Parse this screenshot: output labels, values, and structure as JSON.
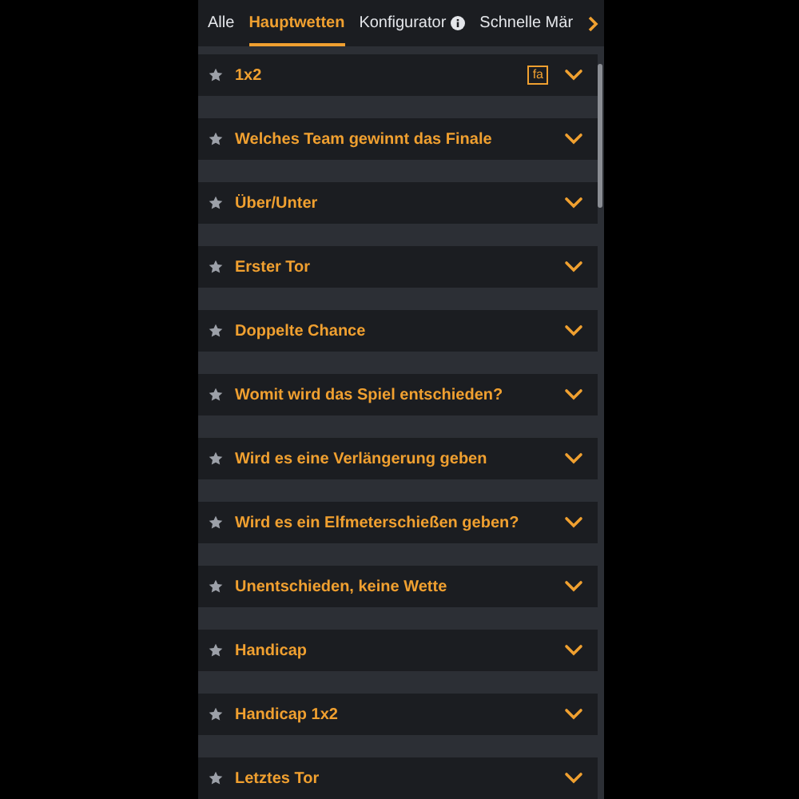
{
  "tabs": [
    {
      "label": "Alle",
      "selected": false
    },
    {
      "label": "Hauptwetten",
      "selected": true
    },
    {
      "label": "Konfigurator",
      "selected": false,
      "info": true
    },
    {
      "label": "Schnelle Mär",
      "selected": false
    }
  ],
  "markets": [
    {
      "title": "1x2",
      "badge": "fa"
    },
    {
      "title": "Welches Team gewinnt das Finale"
    },
    {
      "title": "Über/Unter"
    },
    {
      "title": "Erster Tor"
    },
    {
      "title": "Doppelte Chance"
    },
    {
      "title": "Womit wird das Spiel entschieden?"
    },
    {
      "title": "Wird es eine Verlängerung geben"
    },
    {
      "title": "Wird es ein Elfmeterschießen geben?"
    },
    {
      "title": "Unentschieden, keine Wette"
    },
    {
      "title": "Handicap"
    },
    {
      "title": "Handicap 1x2"
    },
    {
      "title": "Letztes Tor"
    }
  ]
}
